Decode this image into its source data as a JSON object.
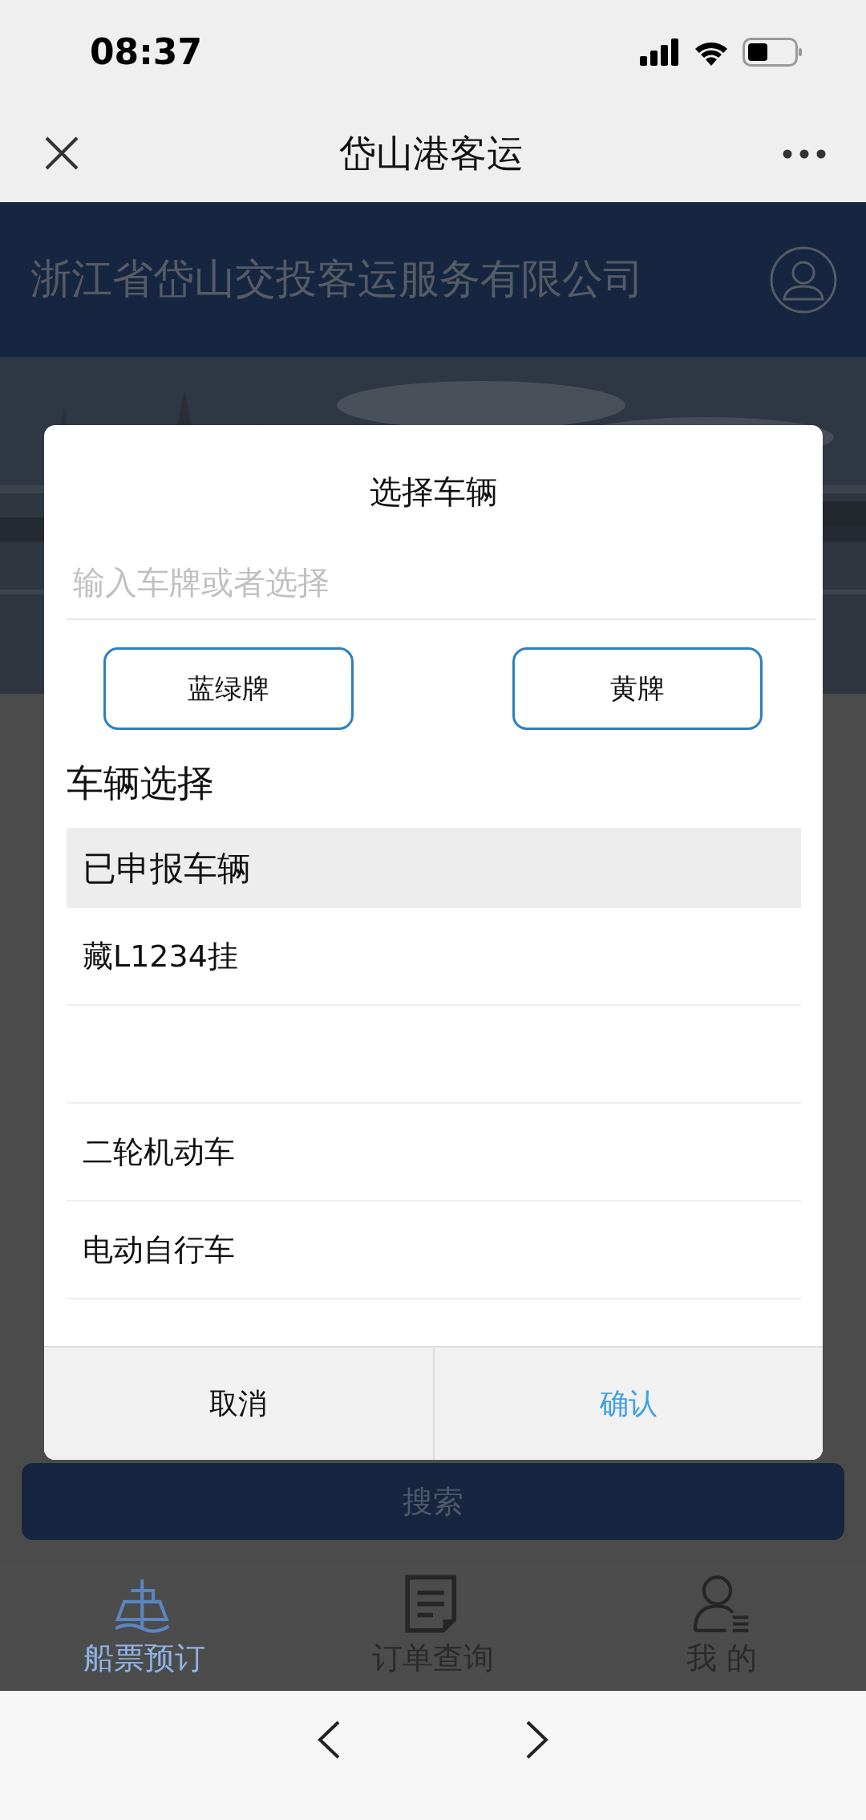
{
  "status_bar": {
    "time": "08:37"
  },
  "nav_bar": {
    "title": "岱山港客运"
  },
  "header": {
    "title": "浙江省岱山交投客运服务有限公司"
  },
  "search_button": {
    "label": "搜索"
  },
  "tab_bar": [
    {
      "label": "船票预订",
      "kind": "ship",
      "selected": true
    },
    {
      "label": "订单查询",
      "kind": "document",
      "selected": false
    },
    {
      "label": "我 的",
      "kind": "person",
      "selected": false
    }
  ],
  "dialog": {
    "title": "选择车辆",
    "plate_input": {
      "placeholder": "输入车牌或者选择"
    },
    "plate_types": [
      "蓝绿牌",
      "黄牌"
    ],
    "section_title": "车辆选择",
    "vehicle_list": [
      {
        "kind": "group",
        "label": "已申报车辆"
      },
      {
        "kind": "item",
        "label": "藏L1234挂"
      },
      {
        "kind": "blank"
      },
      {
        "kind": "item",
        "label": "二轮机动车"
      },
      {
        "kind": "item",
        "label": "电动自行车"
      }
    ],
    "buttons": [
      {
        "kind": "cancel",
        "label": "取消"
      },
      {
        "kind": "confirm",
        "label": "确认"
      }
    ]
  }
}
